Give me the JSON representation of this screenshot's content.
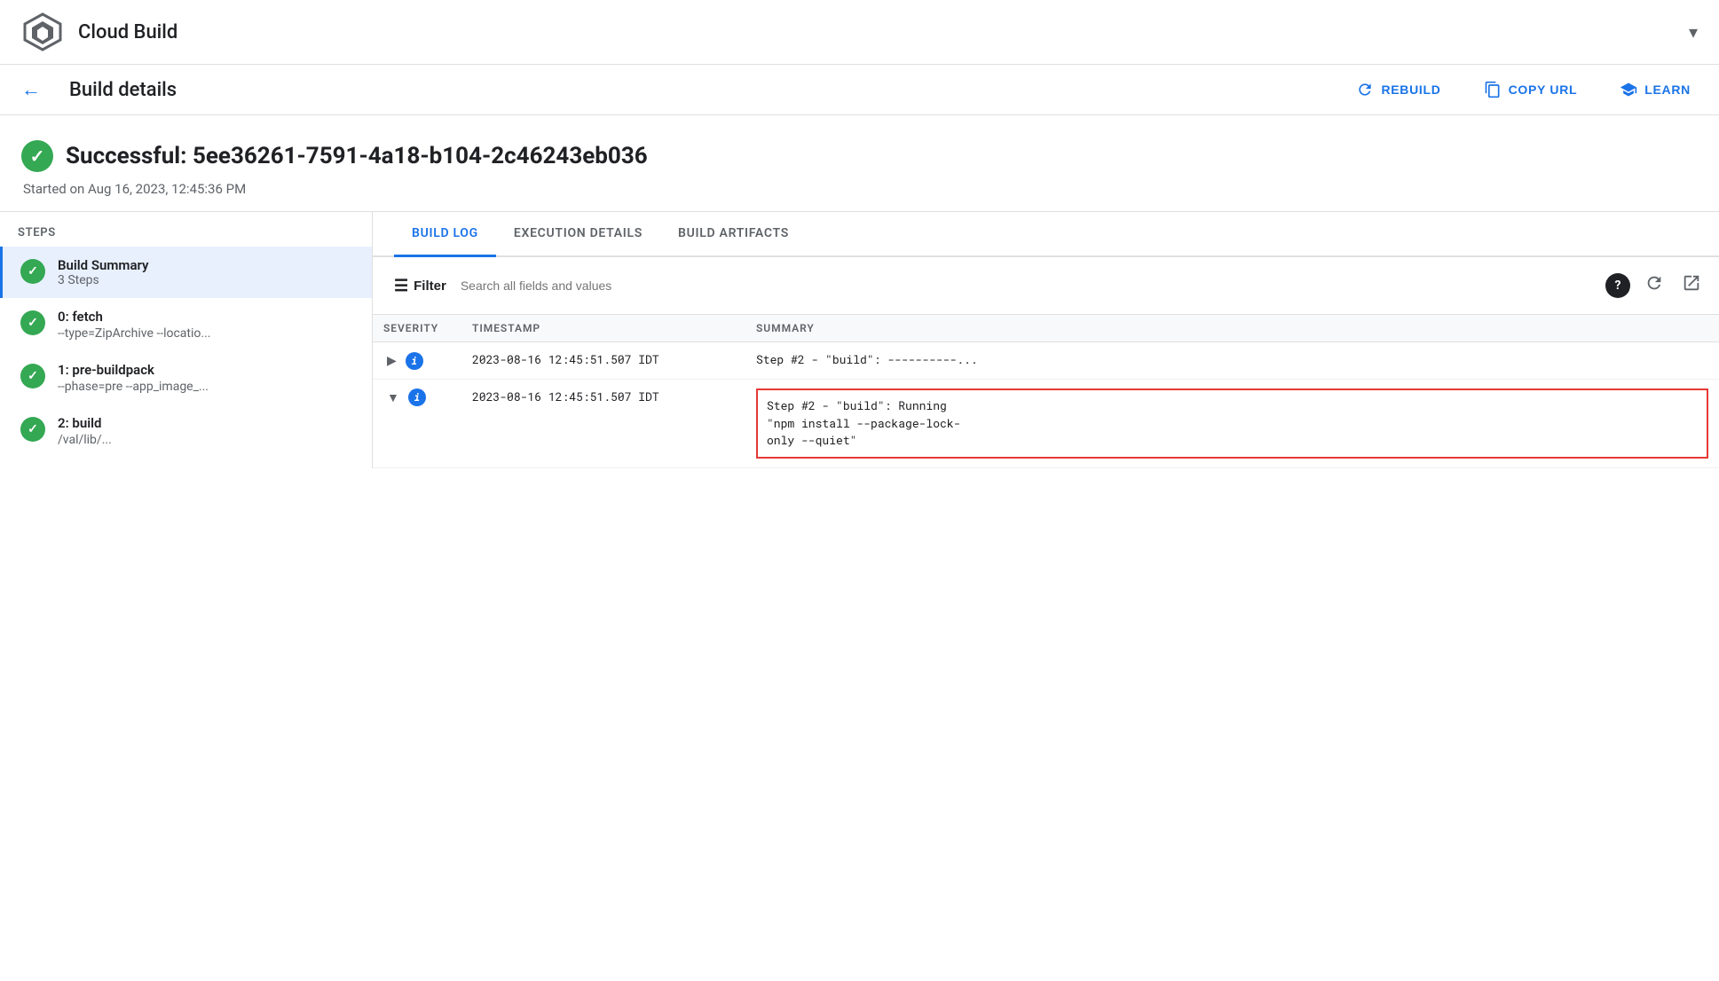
{
  "header": {
    "title": "Cloud Build",
    "chevron": "▾"
  },
  "toolbar": {
    "back_label": "←",
    "page_title": "Build details",
    "rebuild_label": "REBUILD",
    "copy_url_label": "COPY URL",
    "learn_label": "LEARN"
  },
  "build": {
    "status": "Successful: 5ee36261-7591-4a18-b104-2c46243eb036",
    "started": "Started on Aug 16, 2023, 12:45:36 PM"
  },
  "steps_panel": {
    "header": "Steps",
    "items": [
      {
        "name": "Build Summary",
        "sub": "3 Steps",
        "active": true
      },
      {
        "name": "0: fetch",
        "sub": "--type=ZipArchive --locatio..."
      },
      {
        "name": "1: pre-buildpack",
        "sub": "--phase=pre --app_image_..."
      },
      {
        "name": "2: build",
        "sub": "/val/lib/..."
      }
    ]
  },
  "tabs": [
    {
      "label": "BUILD LOG",
      "active": true
    },
    {
      "label": "EXECUTION DETAILS",
      "active": false
    },
    {
      "label": "BUILD ARTIFACTS",
      "active": false
    }
  ],
  "filter": {
    "label": "Filter",
    "placeholder": "Search all fields and values"
  },
  "log_table": {
    "columns": [
      "SEVERITY",
      "TIMESTAMP",
      "SUMMARY"
    ],
    "rows": [
      {
        "expand": "▶",
        "severity_badge": "i",
        "timestamp": "2023-08-16  12:45:51.507 IDT",
        "summary": "Step #2 - \"build\": ----------...",
        "highlighted": false
      },
      {
        "expand": "▼",
        "severity_badge": "i",
        "timestamp": "2023-08-16  12:45:51.507 IDT",
        "summary": "Step #2 - \"build\": Running\n\"npm install --package-lock-\nonly --quiet\"",
        "highlighted": true
      }
    ]
  }
}
